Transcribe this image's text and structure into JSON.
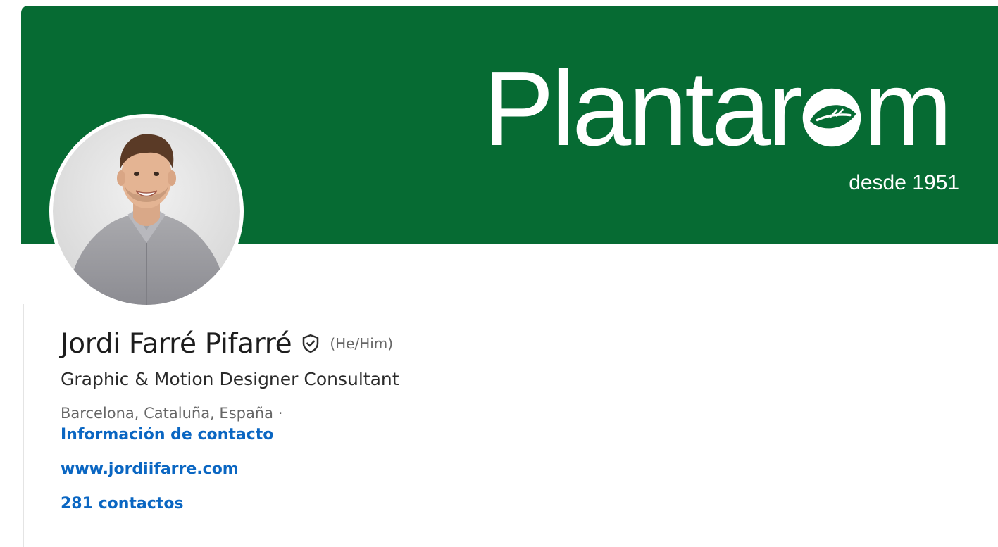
{
  "banner": {
    "brand_name": "Plantarom",
    "brand_name_left": "Plantar",
    "brand_name_right": "m",
    "tagline": "desde 1951",
    "color": "#066b33"
  },
  "profile": {
    "name": "Jordi Farré Pifarré",
    "pronouns": "(He/Him)",
    "headline": "Graphic & Motion Designer Consultant",
    "location": "Barcelona, Cataluña, España ·",
    "contact_info_label": "Información de contacto",
    "website": "www.jordiifarre.com",
    "connections": "281 contactos",
    "verified_icon": "shield-check-icon",
    "link_color": "#0a66c2"
  }
}
